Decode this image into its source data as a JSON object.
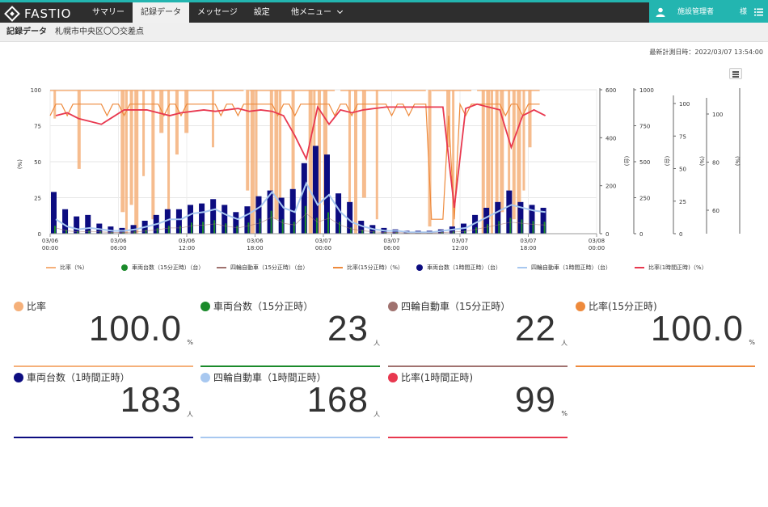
{
  "app": {
    "name": "FASTIO"
  },
  "nav": {
    "items": [
      {
        "label": "サマリー",
        "active": false
      },
      {
        "label": "記録データ",
        "active": true
      },
      {
        "label": "メッセージ",
        "active": false
      },
      {
        "label": "設定",
        "active": false
      }
    ],
    "more_label": "他メニュー"
  },
  "user": {
    "name": "施設管理者",
    "suffix": "様"
  },
  "page": {
    "title": "記録データ",
    "location": "札幌市中央区〇〇交差点"
  },
  "last_updated": "最新計測日時：2022/03/07 13:54:00",
  "colors": {
    "ratio": "#f5b07a",
    "vehicles15": "#1a8a2a",
    "fourwheel15": "#a0726f",
    "ratio15": "#ee8a3c",
    "vehicles1h": "#0c0c80",
    "fourwheel1h": "#a8c8f0",
    "ratio1h": "#e8384f"
  },
  "chart_data": {
    "type": "bar",
    "x_ticks": [
      [
        "03/06",
        "00:00"
      ],
      [
        "03/06",
        "06:00"
      ],
      [
        "03/06",
        "12:00"
      ],
      [
        "03/06",
        "18:00"
      ],
      [
        "03/07",
        "00:00"
      ],
      [
        "03/07",
        "06:00"
      ],
      [
        "03/07",
        "12:00"
      ],
      [
        "03/07",
        "18:00"
      ],
      [
        "03/08",
        "00:00"
      ]
    ],
    "x_range_hours": [
      0,
      48
    ],
    "axes": {
      "left": {
        "label": "(%)",
        "ticks": [
          0,
          25,
          50,
          75,
          100
        ]
      },
      "right1": {
        "ticks": [
          0,
          200,
          400,
          600
        ]
      },
      "right2": {
        "label": "(台)",
        "ticks": [
          0,
          250,
          500,
          750,
          1000
        ]
      },
      "right3": {
        "label": "(台)",
        "ticks": [
          0,
          25,
          50,
          75,
          100
        ]
      },
      "right4": {
        "label": "(%)",
        "ticks": [
          60,
          80,
          100
        ]
      },
      "right5": {
        "label": "(%)"
      }
    },
    "series_hourly_vehicles": [
      29,
      17,
      12,
      13,
      7,
      5,
      4,
      6,
      9,
      13,
      17,
      17,
      20,
      21,
      24,
      20,
      15,
      19,
      26,
      30,
      25,
      31,
      49,
      61,
      55,
      28,
      22,
      9,
      6,
      4,
      3,
      2,
      2,
      2,
      3,
      5,
      7,
      13,
      18,
      22,
      30,
      22,
      20,
      18
    ],
    "series_hourly_fourwheel": [
      10,
      5,
      3,
      4,
      3,
      2,
      2,
      3,
      5,
      7,
      10,
      10,
      14,
      15,
      17,
      13,
      10,
      14,
      19,
      29,
      18,
      15,
      35,
      20,
      27,
      15,
      8,
      5,
      3,
      2,
      2,
      1,
      1,
      1,
      2,
      3,
      4,
      8,
      12,
      16,
      20,
      18,
      16,
      15
    ],
    "series_hourly_ratio": [
      82,
      84,
      80,
      78,
      76,
      81,
      86,
      86,
      86,
      84,
      82,
      84,
      85,
      86,
      85,
      86,
      87,
      85,
      86,
      85,
      82,
      68,
      52,
      88,
      76,
      86,
      84,
      86,
      87,
      88,
      88,
      88,
      88,
      88,
      88,
      18,
      87,
      90,
      88,
      86,
      60,
      82,
      86,
      82
    ],
    "legend": [
      {
        "name": "比率（%）",
        "kind": "line",
        "color_key": "ratio"
      },
      {
        "name": "車両台数（15分正時）（台）",
        "kind": "dot",
        "color_key": "vehicles15"
      },
      {
        "name": "四輪自動車（15分正時）（台）",
        "kind": "line",
        "color_key": "fourwheel15"
      },
      {
        "name": "比率(15分正時)（%）",
        "kind": "line",
        "color_key": "ratio15"
      },
      {
        "name": "車両台数（1時間正時）（台）",
        "kind": "dot",
        "color_key": "vehicles1h"
      },
      {
        "name": "四輪自動車（1時間正時）（台）",
        "kind": "line",
        "color_key": "fourwheel1h"
      },
      {
        "name": "比率(1時間正時)（%）",
        "kind": "line",
        "color_key": "ratio1h"
      }
    ]
  },
  "cards": [
    {
      "title": "比率",
      "value": "100.0",
      "unit": "%",
      "color_key": "ratio"
    },
    {
      "title": "車両台数（15分正時）",
      "value": "23",
      "unit": "人",
      "color_key": "vehicles15"
    },
    {
      "title": "四輪自動車（15分正時）",
      "value": "22",
      "unit": "人",
      "color_key": "fourwheel15"
    },
    {
      "title": "比率(15分正時)",
      "value": "100.0",
      "unit": "%",
      "color_key": "ratio15"
    },
    {
      "title": "車両台数（1時間正時）",
      "value": "183",
      "unit": "人",
      "color_key": "vehicles1h"
    },
    {
      "title": "四輪自動車（1時間正時）",
      "value": "168",
      "unit": "人",
      "color_key": "fourwheel1h"
    },
    {
      "title": "比率(1時間正時)",
      "value": "99",
      "unit": "%",
      "color_key": "ratio1h"
    }
  ]
}
